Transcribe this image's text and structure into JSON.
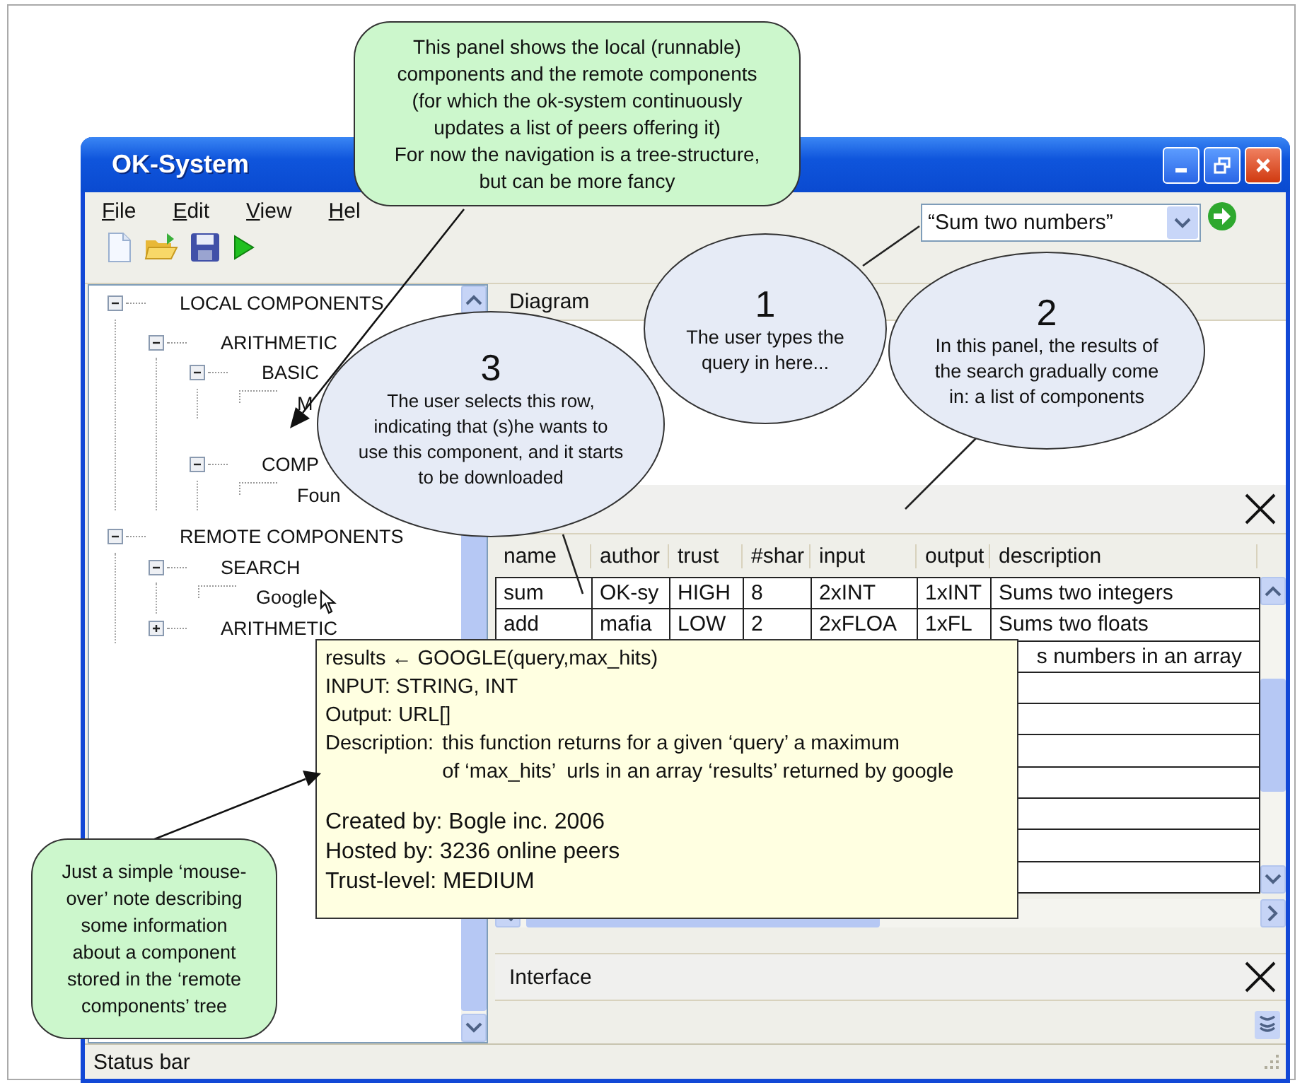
{
  "window": {
    "title": "OK-System"
  },
  "menu": [
    {
      "label": "File"
    },
    {
      "label": "Edit"
    },
    {
      "label": "View"
    },
    {
      "label": "Hel"
    }
  ],
  "search": {
    "value": "“Sum two numbers”"
  },
  "tree": [
    {
      "label": "LOCAL COMPONENTS",
      "kind": "folder",
      "expanded": true,
      "children": [
        {
          "label": "ARITHMETIC",
          "kind": "folder",
          "expanded": true,
          "children": [
            {
              "label": "BASIC",
              "kind": "folder",
              "expanded": true,
              "children": [
                {
                  "label": "M",
                  "kind": "leaf"
                }
              ]
            },
            {
              "label": "COMP",
              "kind": "folder",
              "expanded": true,
              "children": [
                {
                  "label": "Foun",
                  "kind": "leaf"
                }
              ]
            }
          ]
        }
      ]
    },
    {
      "label": "REMOTE COMPONENTS",
      "kind": "folder",
      "expanded": true,
      "children": [
        {
          "label": "SEARCH",
          "kind": "folder",
          "expanded": true,
          "children": [
            {
              "label": "Google",
              "kind": "leaf"
            }
          ]
        },
        {
          "label": "ARITHMETIC",
          "kind": "folder",
          "expanded": false
        }
      ]
    }
  ],
  "diagram_panel": {
    "title": "Diagram"
  },
  "results_panel": {
    "columns": [
      "name",
      "author",
      "trust",
      "#shar",
      "input",
      "output",
      "description"
    ],
    "rows": [
      [
        "sum",
        "OK-sy",
        "HIGH",
        "8",
        "2xINT",
        "1xINT",
        "Sums two integers"
      ],
      [
        "add",
        "mafia",
        "LOW",
        "2",
        "2xFLOA",
        "1xFL",
        "Sums two floats"
      ],
      [
        null,
        null,
        null,
        null,
        null,
        null,
        "s numbers in an array"
      ]
    ]
  },
  "interface_panel": {
    "title": "Interface"
  },
  "status_bar": "Status bar",
  "tooltip": {
    "head": [
      "results ← GOOGLE(query,max_hits)",
      "INPUT: STRING, INT",
      "Output: URL[]"
    ],
    "description_label": "Description:",
    "description": [
      "this function returns for a given ‘query’ a maximum",
      "of ‘max_hits’  urls in an array ‘results’ returned by google"
    ],
    "foot": [
      "Created by: Bogle inc. 2006",
      "Hosted by: 3236 online peers",
      "Trust-level: MEDIUM"
    ]
  },
  "annotations": [
    {
      "kind": "note",
      "text": "This panel shows the local (runnable)\ncomponents and the remote components\n(for which the ok-system continuously\nupdates a list of peers offering it)\nFor now the navigation is a tree-structure,\nbut can be more fancy"
    },
    {
      "kind": "bubble",
      "number": "1",
      "text": "The user types the\nquery in here..."
    },
    {
      "kind": "bubble",
      "number": "2",
      "text": "In this panel, the results of\nthe search gradually come\nin: a list of components"
    },
    {
      "kind": "bubble",
      "number": "3",
      "text": "The user selects this row,\nindicating that (s)he wants to\nuse this component, and it starts\nto be downloaded"
    },
    {
      "kind": "note",
      "text": "Just a simple ‘mouse-\nover’ note describing\nsome information\nabout a component\nstored in the ‘remote\ncomponents’ tree"
    }
  ]
}
